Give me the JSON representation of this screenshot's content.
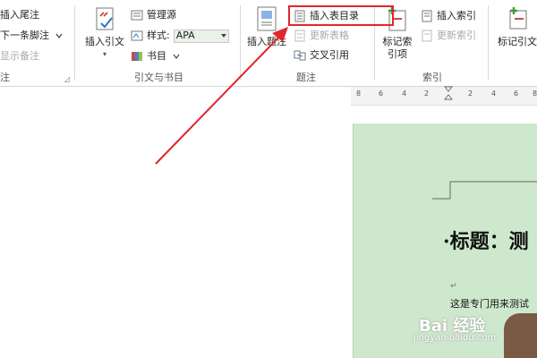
{
  "ribbon": {
    "footnotes": {
      "insert_endnote": "插入尾注",
      "next_footnote": "下一条脚注",
      "show_notes": "显示备注",
      "group_label": "注"
    },
    "citations": {
      "insert_citation": "插入引文",
      "manage_sources": "管理源",
      "style_label": "样式:",
      "style_value": "APA",
      "bibliography": "书目",
      "group_label": "引文与书目"
    },
    "captions": {
      "insert_caption": "插入题注",
      "insert_table_of_figures": "插入表目录",
      "update_table": "更新表格",
      "cross_reference": "交叉引用",
      "group_label": "题注"
    },
    "index": {
      "mark_entry": "标记索引项",
      "insert_index": "插入索引",
      "update_index": "更新索引",
      "group_label": "索引"
    },
    "toa": {
      "mark_citation": "标记引文"
    }
  },
  "ruler": {
    "ticks": [
      "8",
      "6",
      "4",
      "2",
      "2",
      "4",
      "6",
      "8"
    ]
  },
  "document": {
    "heading": "·标题：测",
    "paragraph_mark": "↵",
    "body_text": "这是专门用来测试"
  },
  "watermark": {
    "main": "Bai 经验",
    "sub": "jingyan.baidu.com"
  },
  "colors": {
    "page_bg": "#cde8cd",
    "highlight_border": "#e0262b",
    "arrow": "#e0262b",
    "style_box_bg": "#e8f2e8"
  }
}
